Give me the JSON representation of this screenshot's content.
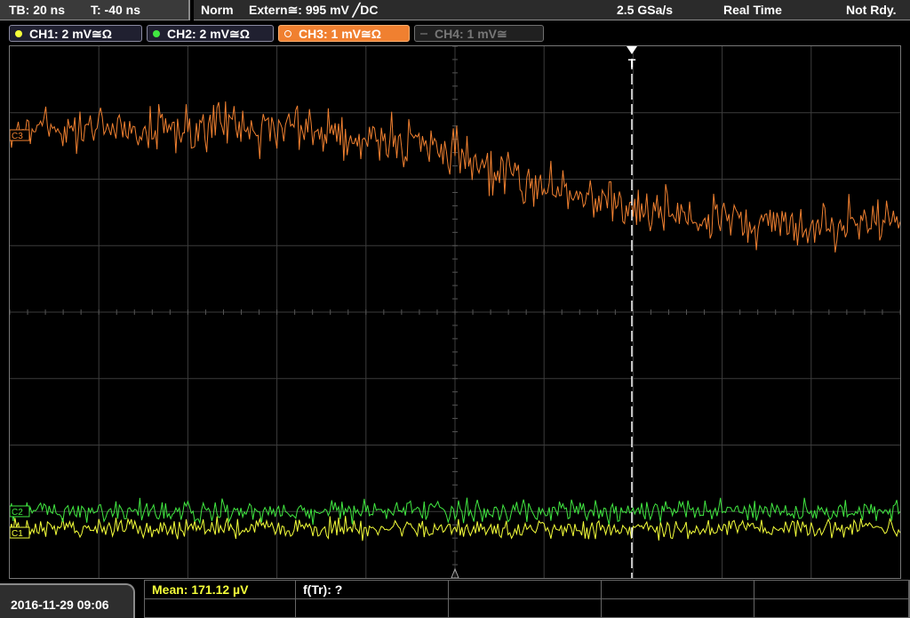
{
  "header": {
    "timebase": "TB: 20 ns",
    "trigger_time": "T: -40 ns",
    "mode": "Norm",
    "trigger_source": "Extern≅: 995 mV ╱DC",
    "sample_rate": "2.5 GSa/s",
    "acq_mode": "Real Time",
    "status": "Not Rdy."
  },
  "channels": [
    {
      "label": "CH1: 2 mV≅Ω",
      "color": "#f5ff3a",
      "active": true
    },
    {
      "label": "CH2: 2 mV≅Ω",
      "color": "#41e841",
      "active": true
    },
    {
      "label": "CH3: 1 mV≅Ω",
      "color": "#f08030",
      "active": true,
      "selected": true
    },
    {
      "label": "CH4: 1 mV≅",
      "color": "#777777",
      "active": false
    }
  ],
  "markers": {
    "ch3": "C3",
    "ch2": "C2",
    "ch1": "C1",
    "trigger": "T"
  },
  "footer": {
    "datetime": "2016-11-29 09:06",
    "mean": "Mean: 171.12 µV",
    "ftr": "f(Tr): ?"
  },
  "colors": {
    "ch1": "#f5ff3a",
    "ch2": "#41e841",
    "ch3": "#f08030",
    "grid": "#3c3c3c"
  },
  "chart_data": {
    "type": "line",
    "xlabel": "",
    "ylabel": "",
    "grid": true,
    "series": [
      {
        "name": "CH3",
        "description_values": [
          0.0,
          0.0,
          0.0,
          0.0,
          -0.1,
          -0.35,
          -0.55,
          -0.7,
          -0.72,
          -0.72
        ]
      },
      {
        "name": "CH2",
        "description_values": [
          0.0,
          0.0,
          0.0,
          0.0,
          0.0,
          0.0,
          0.0,
          0.0,
          0.0,
          0.0
        ]
      },
      {
        "name": "CH1",
        "description_values": [
          0.0,
          0.0,
          0.0,
          0.0,
          0.0,
          0.0,
          0.0,
          0.0,
          0.0,
          0.0
        ]
      }
    ]
  }
}
